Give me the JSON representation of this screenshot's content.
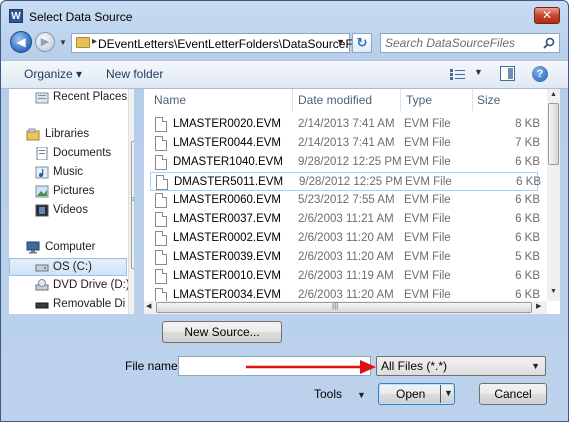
{
  "window": {
    "title": "Select Data Source",
    "app_icon_letter": "W",
    "close_label": "✕"
  },
  "address": {
    "path": "DEventLetters\\EventLetterFolders\\DataSourceFiles",
    "separator": "▸"
  },
  "search": {
    "placeholder": "Search DataSourceFiles"
  },
  "toolbar": {
    "organize_label": "Organize ▾",
    "new_folder_label": "New folder",
    "help_label": "?"
  },
  "navpane": {
    "items": [
      {
        "label": "Recent Places",
        "icon": "recent-places-icon"
      },
      {
        "label": "Libraries",
        "icon": "libraries-icon"
      },
      {
        "label": "Documents",
        "icon": "documents-icon"
      },
      {
        "label": "Music",
        "icon": "music-icon"
      },
      {
        "label": "Pictures",
        "icon": "pictures-icon"
      },
      {
        "label": "Videos",
        "icon": "videos-icon"
      },
      {
        "label": "Computer",
        "icon": "computer-icon"
      },
      {
        "label": "OS (C:)",
        "icon": "drive-icon",
        "selected": true
      },
      {
        "label": "DVD Drive (D:)",
        "icon": "dvd-drive-icon"
      },
      {
        "label": "Removable Di",
        "icon": "removable-disk-icon"
      }
    ]
  },
  "filelist": {
    "columns": [
      "Name",
      "Date modified",
      "Type",
      "Size"
    ],
    "rows": [
      {
        "name": "LMASTER0020.EVM",
        "date": "2/14/2013 7:41 AM",
        "type": "EVM File",
        "size": "8 KB"
      },
      {
        "name": "LMASTER0044.EVM",
        "date": "2/14/2013 7:41 AM",
        "type": "EVM File",
        "size": "7 KB"
      },
      {
        "name": "DMASTER1040.EVM",
        "date": "9/28/2012 12:25 PM",
        "type": "EVM File",
        "size": "6 KB"
      },
      {
        "name": "DMASTER5011.EVM",
        "date": "9/28/2012 12:25 PM",
        "type": "EVM File",
        "size": "6 KB",
        "selected": true
      },
      {
        "name": "LMASTER0060.EVM",
        "date": "5/23/2012 7:55 AM",
        "type": "EVM File",
        "size": "6 KB"
      },
      {
        "name": "LMASTER0037.EVM",
        "date": "2/6/2003 11:21 AM",
        "type": "EVM File",
        "size": "6 KB"
      },
      {
        "name": "LMASTER0002.EVM",
        "date": "2/6/2003 11:20 AM",
        "type": "EVM File",
        "size": "6 KB"
      },
      {
        "name": "LMASTER0039.EVM",
        "date": "2/6/2003 11:20 AM",
        "type": "EVM File",
        "size": "5 KB"
      },
      {
        "name": "LMASTER0010.EVM",
        "date": "2/6/2003 11:19 AM",
        "type": "EVM File",
        "size": "6 KB"
      },
      {
        "name": "LMASTER0034.EVM",
        "date": "2/6/2003 11:20 AM",
        "type": "EVM File",
        "size": "6 KB"
      }
    ]
  },
  "bottom": {
    "new_source_label": "New Source...",
    "file_name_label": "File name:",
    "file_name_value": "",
    "filter_label": "All Files (*.*)",
    "tools_label": "Tools",
    "open_label": "Open",
    "cancel_label": "Cancel"
  },
  "colors": {
    "annotation_arrow": "#e01010"
  }
}
